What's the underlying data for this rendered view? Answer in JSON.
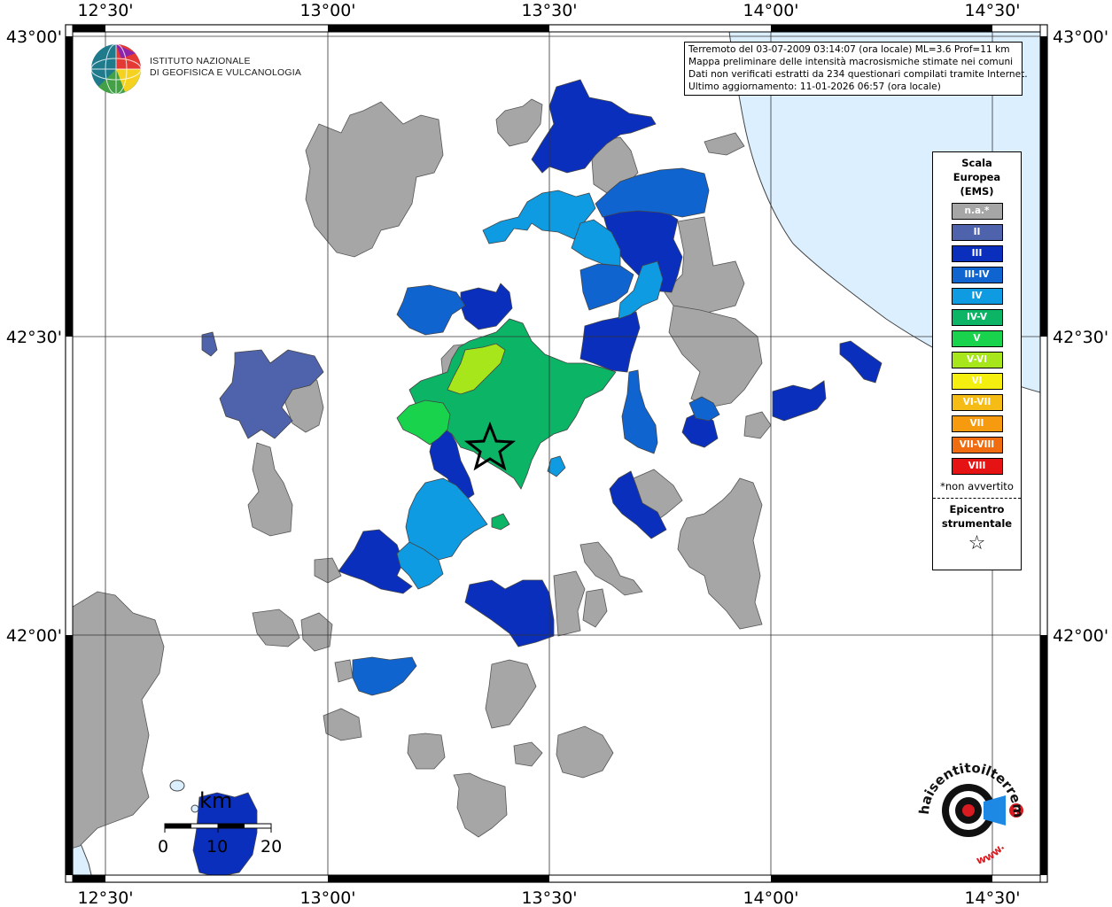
{
  "header": {
    "line1": "Terremoto del 03-07-2009 03:14:07 (ora locale) ML=3.6 Prof=11 km",
    "line2": "Mappa preliminare delle intensità macrosismiche stimate nei comuni",
    "line3": "Dati non verificati estratti da 234 questionari compilati tramite Internet.",
    "line4": "Ultimo aggiornamento: 11-01-2026 06:57 (ora locale)"
  },
  "institution": {
    "line1": "ISTITUTO NAZIONALE",
    "line2": "DI GEOFISICA E VULCANOLOGIA"
  },
  "axes": {
    "top": [
      "12°30'",
      "13°00'",
      "13°30'",
      "14°00'",
      "14°30'"
    ],
    "bottom": [
      "12°30'",
      "13°00'",
      "13°30'",
      "14°00'",
      "14°30'"
    ],
    "left": [
      "43°00'",
      "42°30'",
      "42°00'"
    ],
    "right": [
      "43°00'",
      "42°30'",
      "42°00'"
    ]
  },
  "legend": {
    "title_line1": "Scala",
    "title_line2": "Europea",
    "title_line3": "(EMS)",
    "items": [
      {
        "label": "n.a.*",
        "color": "#a6a6a6"
      },
      {
        "label": "II",
        "color": "#4f63ad"
      },
      {
        "label": "III",
        "color": "#0a2fbd"
      },
      {
        "label": "III-IV",
        "color": "#0f64cf"
      },
      {
        "label": "IV",
        "color": "#0e9be2"
      },
      {
        "label": "IV-V",
        "color": "#0cb466"
      },
      {
        "label": "V",
        "color": "#19d34c"
      },
      {
        "label": "V-VI",
        "color": "#a7e61b"
      },
      {
        "label": "VI",
        "color": "#f4ef0f"
      },
      {
        "label": "VI-VII",
        "color": "#f4bc14"
      },
      {
        "label": "VII",
        "color": "#f69a10"
      },
      {
        "label": "VII-VIII",
        "color": "#ef6c10"
      },
      {
        "label": "VIII",
        "color": "#e51313"
      }
    ],
    "note": "*non avvertito",
    "epicenter_line1": "Epicentro",
    "epicenter_line2": "strumentale"
  },
  "scalebar": {
    "unit": "km",
    "ticks": [
      "0",
      "10",
      "20"
    ]
  },
  "colors": {
    "sea": "#dcefff",
    "na": "#a6a6a6",
    "II": "#4f63ad",
    "III": "#0a2fbd",
    "III-IV": "#0f64cf",
    "IV": "#0e9be2",
    "IV-V": "#0cb466",
    "V": "#19d34c",
    "V-VI": "#a7e61b"
  },
  "logo": {
    "website": "www.haisentitoilterremoto.it"
  }
}
